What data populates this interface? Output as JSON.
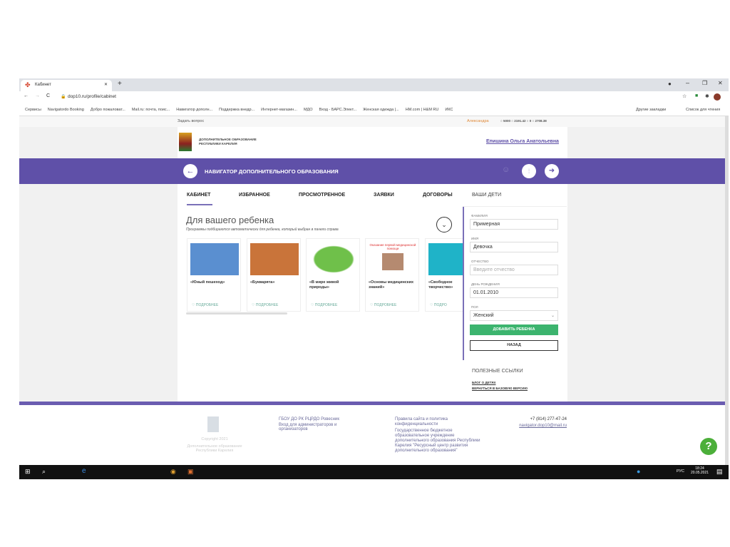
{
  "browser": {
    "tab_title": "Кабинет",
    "url": "dop10.ru/profile/cabinet",
    "bookmarks": [
      "Сервисы",
      "Navigatordo Booking",
      "Добро пожаловат...",
      "Mail.ru: почта, поис...",
      "Навигатор дополн...",
      "Поддержка внедр...",
      "Интернет-магазин...",
      "МДО",
      "Вход - БАРС.Элект...",
      "Женская одежда |...",
      "HM.com | H&M RU",
      "ИКС"
    ],
    "other_bookmarks": "Другие закладки",
    "reading_list": "Список для чтения"
  },
  "topbar": {
    "ask": "Задать вопрос",
    "user": "Александра",
    "stats": [
      "5000",
      "2191.42",
      "0",
      "2708.38"
    ]
  },
  "header": {
    "org": "ДОПОЛНИТЕЛЬНОЕ ОБРАЗОВАНИЕ",
    "org2": "РЕСПУБЛИКИ КАРЕЛИЯ",
    "user_name": "Епишина Ольга Анатольевна",
    "nav_title": "НАВИГАТОР ДОПОЛНИТЕЛЬНОГО ОБРАЗОВАНИЯ"
  },
  "tabs": [
    "КАБИНЕТ",
    "ИЗБРАННОЕ",
    "ПРОСМОТРЕННОЕ",
    "ЗАЯВКИ",
    "ДОГОВОРЫ"
  ],
  "section": {
    "title": "Для вашего ребенка",
    "subtitle": "Программы подбираются автоматически для ребенка, который выбран в панели справа"
  },
  "cards": [
    {
      "title": "«Юный пешеход»",
      "more": "ПОДРОБНЕЕ",
      "color": "#5a8fd0"
    },
    {
      "title": "«Букварята»",
      "more": "ПОДРОБНЕЕ",
      "color": "#c9743a"
    },
    {
      "title": "«В мире живой природы»",
      "more": "ПОДРОБНЕЕ",
      "color": "#6fc04a"
    },
    {
      "title": "«Основы медицинских знаний»",
      "more": "ПОДРОБНЕЕ",
      "color": "#b58a70",
      "img_caption": "Оказание первой медицинской помощи"
    },
    {
      "title": "«Свободное творчество»",
      "more": "ПОДРО",
      "color": "#1fb3c8"
    }
  ],
  "panel": {
    "title": "ВАШИ ДЕТИ",
    "fields": [
      {
        "label": "ФАМИЛИЯ",
        "value": "Примерная"
      },
      {
        "label": "ИМЯ",
        "value": "Девочка"
      },
      {
        "label": "ОТЧЕСТВО",
        "placeholder": "Введите отчество"
      },
      {
        "label": "ДЕНЬ РОЖДЕНИЯ",
        "value": "01.01.2010"
      },
      {
        "label": "ПОЛ",
        "value": "Женский"
      }
    ],
    "add": "ДОБАВИТЬ РЕБЕНКА",
    "back": "НАЗАД",
    "links_title": "ПОЛЕЗНЫЕ ССЫЛКИ",
    "links": [
      "БЛОГ О ДЕТЯХ",
      "ВЕРНУТЬСЯ В БАЗОВУЮ ВЕРСИЮ"
    ]
  },
  "footer": {
    "copyright": "Copyright 2021",
    "org": "Дополнительное образование Республики Карелия",
    "c2_1": "ГБОУ ДО РК РЦРДО Ровесник",
    "c2_2": "Вход для администраторов и организаторов",
    "c3_1": "Правила сайта и политика конфиденциальности",
    "c3_2": "Государственное бюджетное образовательное учреждение дополнительного образования Республики Карелия \"Ресурсный центр развития дополнительного образования\"",
    "phone": "+7 (814) 277-47-24",
    "email": "navigator.dop10@mail.ru"
  },
  "taskbar": {
    "lang": "РУС",
    "time": "18:24",
    "date": "20.05.2021"
  }
}
